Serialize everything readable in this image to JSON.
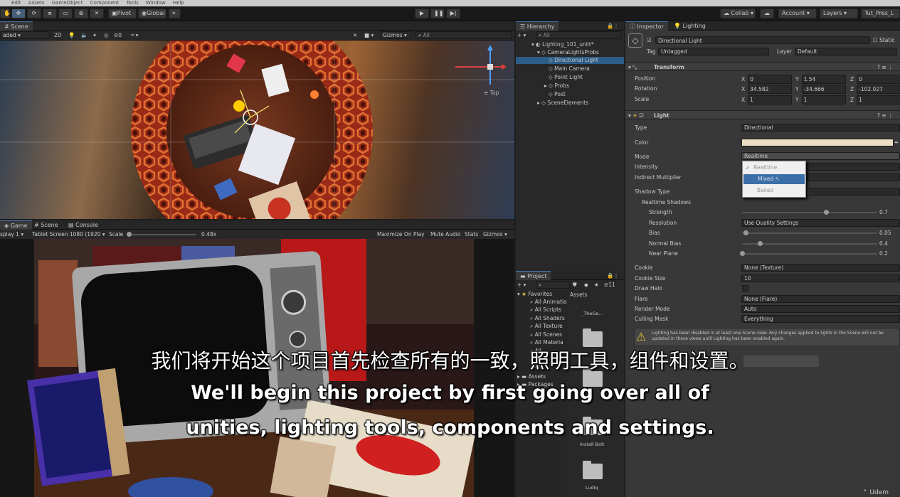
{
  "menubar": [
    "Edit",
    "Assets",
    "GameObject",
    "Component",
    "Tools",
    "Window",
    "Help"
  ],
  "toolbar": {
    "pivot": "Pivot",
    "global": "Global",
    "collab": "Collab",
    "account": "Account",
    "layers": "Layers",
    "layout": "Tut_Pres_L"
  },
  "scene_view": {
    "tab": "Scene",
    "shading": "aded",
    "mode_2d": "2D",
    "gizmos": "Gizmos",
    "search": "All",
    "orientation": "Top",
    "overlay_count": "0"
  },
  "game_view": {
    "tabs": [
      "Game",
      "Scene",
      "Console"
    ],
    "display": "splay 1",
    "resolution": "Tablet Screen 1080 (1920",
    "scale_label": "Scale",
    "scale_value": "0.48x",
    "maximize": "Maximize On Play",
    "mute": "Mute Audio",
    "stats": "Stats",
    "gizmos": "Gizmos"
  },
  "hierarchy": {
    "title": "Hierarchy",
    "search": "All",
    "items": [
      {
        "label": "Lighting_101_unlit*",
        "depth": 0
      },
      {
        "label": "CameraLightsProbs",
        "depth": 1
      },
      {
        "label": "Directional Light",
        "depth": 2,
        "selected": true
      },
      {
        "label": "Main Camera",
        "depth": 2
      },
      {
        "label": "Point Light",
        "depth": 2
      },
      {
        "label": "Probs",
        "depth": 2
      },
      {
        "label": "Post",
        "depth": 2
      },
      {
        "label": "SceneElements",
        "depth": 1
      }
    ]
  },
  "project": {
    "title": "Project",
    "count": "11",
    "favorites_label": "Favorites",
    "favorites": [
      "All Animatio",
      "All Scripts",
      "All Shaders",
      "All Texture",
      "All Scenes",
      "All Materia",
      "All",
      "All",
      "All"
    ],
    "roots": [
      "Assets",
      "Packages"
    ],
    "assets_header": "Assets",
    "files": [
      "_TheGa...",
      "",
      "",
      "Install Bolt",
      "Ludiq"
    ]
  },
  "inspector": {
    "tabs": [
      "Inspector",
      "Lighting"
    ],
    "object_name": "Directional Light",
    "static_label": "Static",
    "tag_label": "Tag",
    "tag": "Untagged",
    "layer_label": "Layer",
    "layer": "Default",
    "transform": {
      "title": "Transform",
      "rows": [
        {
          "label": "Position",
          "x": "0",
          "y": "1.54",
          "z": "0"
        },
        {
          "label": "Rotation",
          "x": "34.582",
          "y": "-34.666",
          "z": "-102.027"
        },
        {
          "label": "Scale",
          "x": "1",
          "y": "1",
          "z": "1"
        }
      ]
    },
    "light": {
      "title": "Light",
      "type_label": "Type",
      "type": "Directional",
      "color_label": "Color",
      "color": "#ece0c4",
      "mode_label": "Mode",
      "mode": "Realtime",
      "intensity_label": "Intensity",
      "indirect_label": "Indirect Multiplier",
      "mode_options": [
        "Realtime",
        "Mixed",
        "Baked"
      ],
      "shadow_type_label": "Shadow Type",
      "realtime_shadows_label": "Realtime Shadows",
      "strength_label": "Strength",
      "strength": "0.7",
      "strength_frac": 0.62,
      "resolution_label": "Resolution",
      "resolution": "Use Quality Settings",
      "bias_label": "Bias",
      "bias": "0.05",
      "bias_frac": 0.025,
      "normal_bias_label": "Normal Bias",
      "normal_bias": "0.4",
      "normal_bias_frac": 0.133,
      "near_plane_label": "Near Plane",
      "near_plane": "0.2",
      "near_plane_frac": 0.0,
      "cookie_label": "Cookie",
      "cookie": "None (Texture)",
      "cookie_size_label": "Cookie Size",
      "cookie_size": "10",
      "draw_halo_label": "Draw Halo",
      "flare_label": "Flare",
      "flare": "None (Flare)",
      "render_mode_label": "Render Mode",
      "render_mode": "Auto",
      "culling_mask_label": "Culling Mask",
      "culling_mask": "Everything",
      "warning": "Lighting has been disabled in at least one Scene view. Any changes applied to lights in the Scene will not be updated in these views until Lighting has been enabled again."
    }
  },
  "subtitles": {
    "cn": "我们将开始这个项目首先检查所有的一致，照明工具，组件和设置。",
    "en1": "We'll begin this project by first going over all of",
    "en2": "unities, lighting tools, components and settings."
  },
  "watermark": "Udem"
}
